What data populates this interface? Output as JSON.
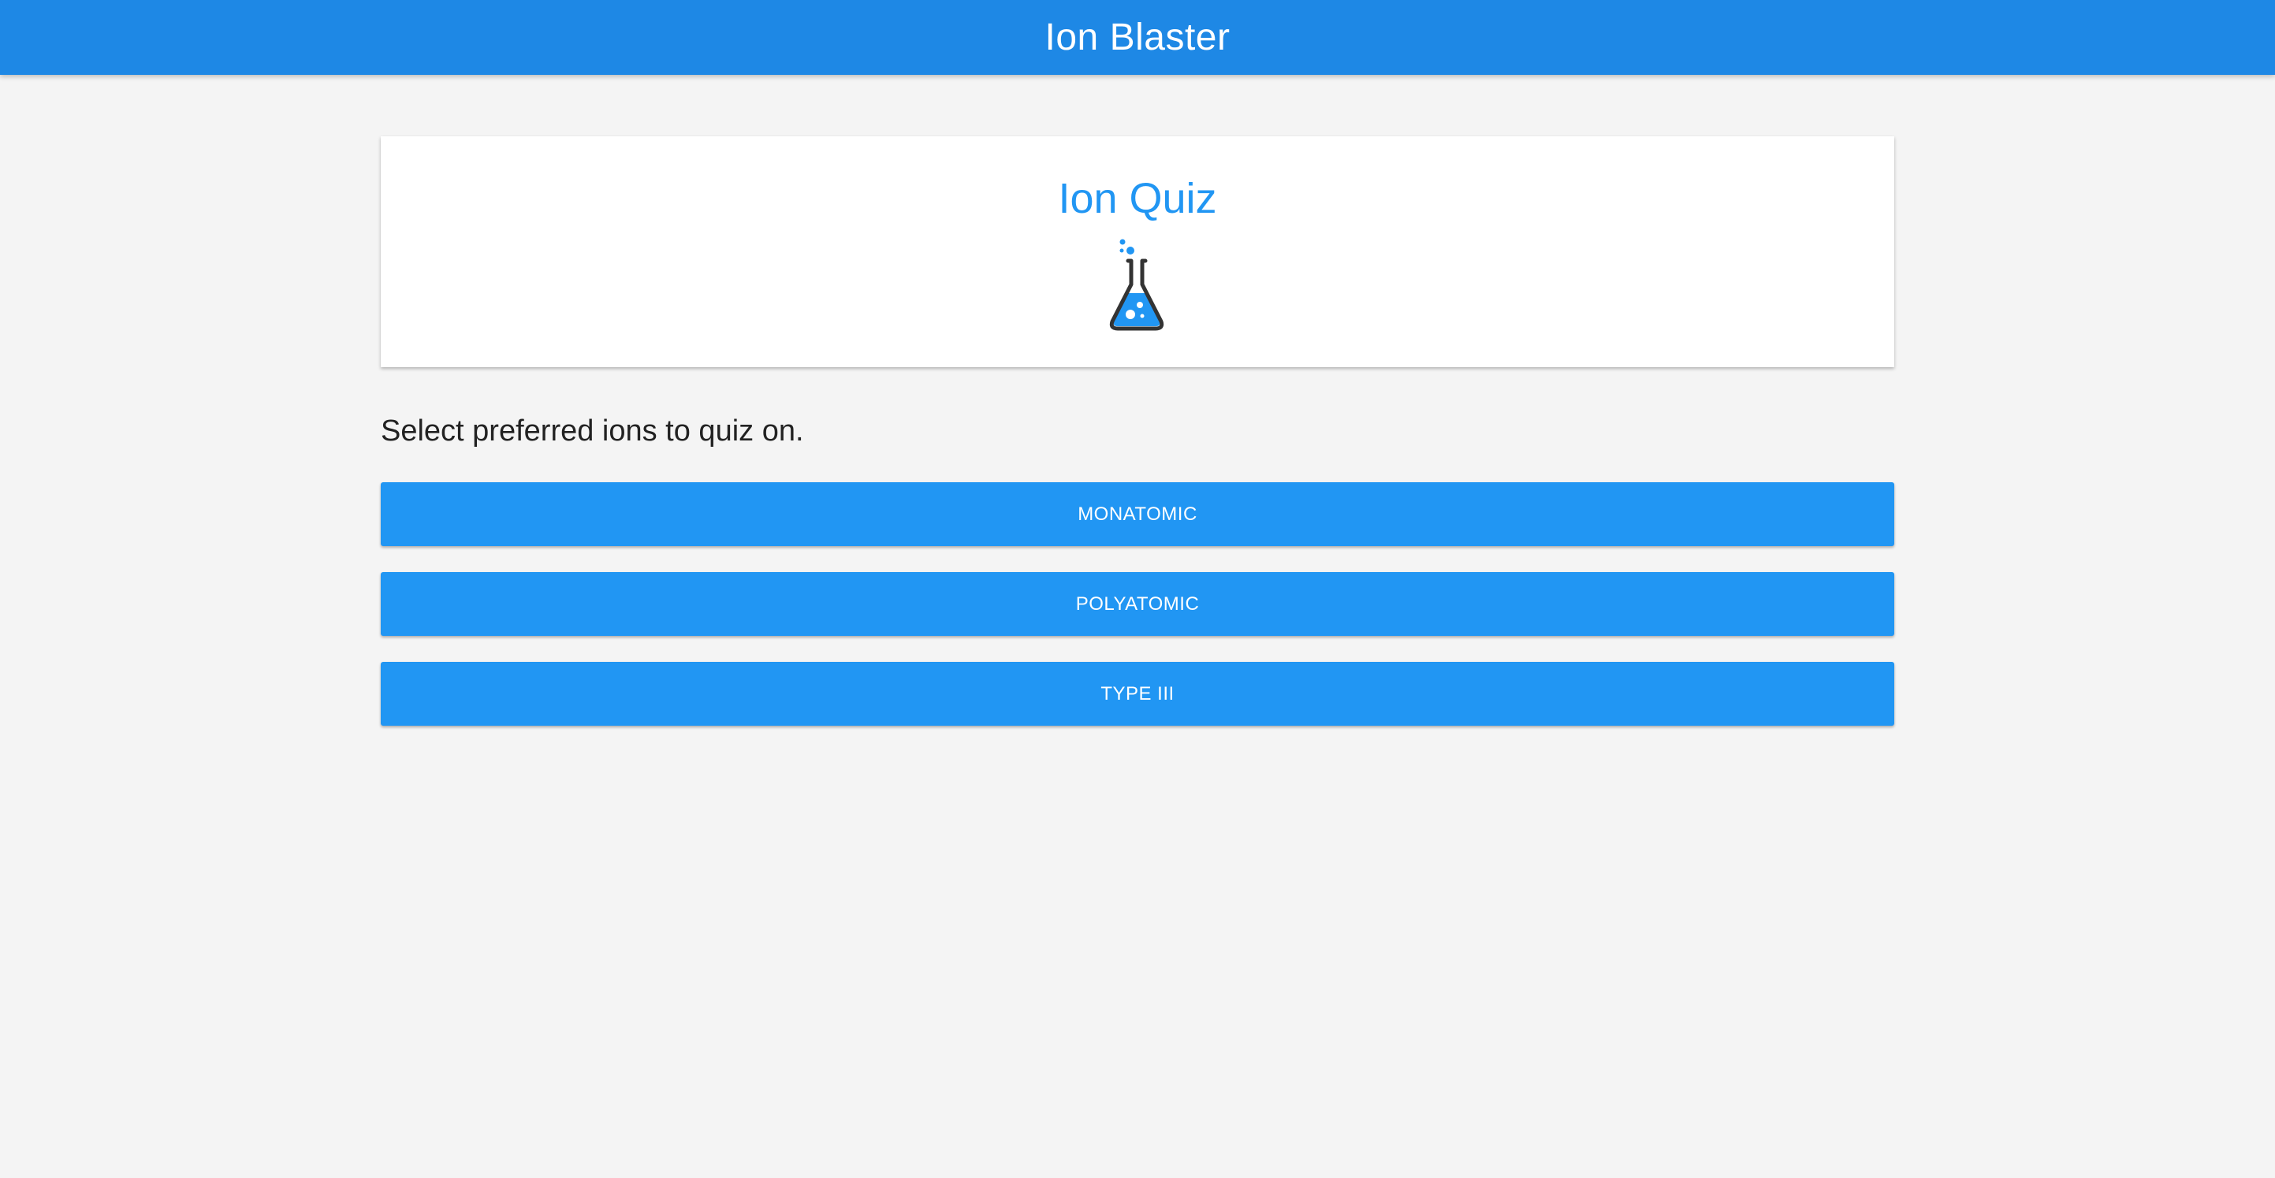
{
  "app": {
    "title": "Ion Blaster"
  },
  "card": {
    "title": "Ion Quiz",
    "icon": "flask-icon"
  },
  "instructions": "Select preferred ions to quiz on.",
  "options": [
    {
      "label": "MONATOMIC"
    },
    {
      "label": "POLYATOMIC"
    },
    {
      "label": "TYPE III"
    }
  ],
  "colors": {
    "app_bar": "#1e88e5",
    "accent": "#2196f3",
    "background": "#f4f4f4",
    "card": "#ffffff",
    "flask_outline": "#333333"
  }
}
